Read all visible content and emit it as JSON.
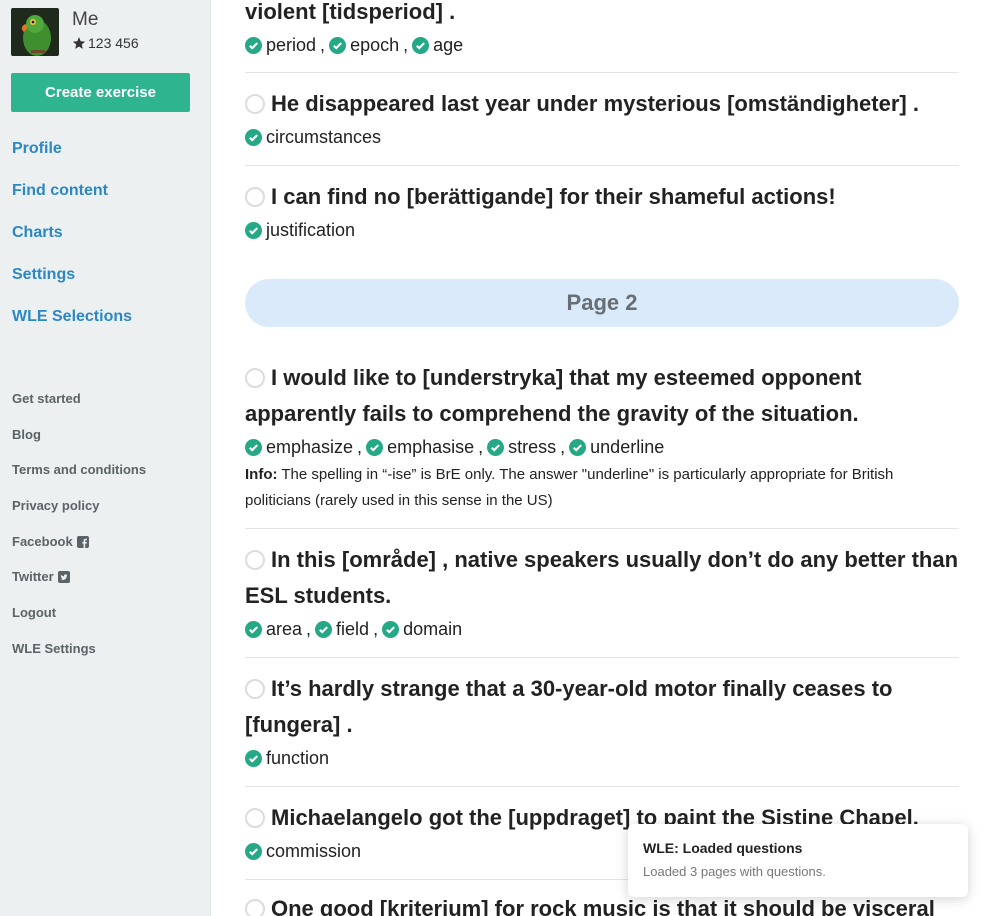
{
  "user": {
    "name": "Me",
    "score": "123 456"
  },
  "sidebar": {
    "create_label": "Create exercise",
    "main_links": [
      "Profile",
      "Find content",
      "Charts",
      "Settings",
      "WLE Selections"
    ],
    "secondary_links": [
      "Get started",
      "Blog",
      "Terms and conditions",
      "Privacy policy",
      "Facebook",
      "Twitter",
      "Logout",
      "WLE Settings"
    ]
  },
  "questions": [
    {
      "text": "violent [tidsperiod] .",
      "answers": [
        "period",
        "epoch",
        "age"
      ]
    },
    {
      "text": "He disappeared last year under mysterious [omständigheter] .",
      "answers": [
        "circumstances"
      ]
    },
    {
      "text": "I can find no [berättigande] for their shameful actions!",
      "answers": [
        "justification"
      ]
    },
    {
      "text": "I would like to [understryka] that my esteemed opponent apparently fails to comprehend the gravity of the situation.",
      "answers": [
        "emphasize",
        "emphasise",
        "stress",
        "underline"
      ],
      "info_label": "Info:",
      "info": " The spelling in “-ise” is BrE only. The answer \"underline\" is particularly appropriate for British politicians (rarely used in this sense in the US)"
    },
    {
      "text": "In this [område] , native speakers usually don’t do any better than ESL students.",
      "answers": [
        "area",
        "field",
        "domain"
      ]
    },
    {
      "text": "It’s hardly strange that a 30-year-old motor finally ceases to [fungera] .",
      "answers": [
        "function"
      ]
    },
    {
      "text": "Michaelangelo got the [uppdraget] to paint the Sistine Chapel.",
      "answers": [
        "commission"
      ]
    },
    {
      "text": "One good [kriterium] for rock music is that it should be visceral",
      "answers": []
    }
  ],
  "page_banner": "Page 2",
  "toast": {
    "title": "WLE: Loaded questions",
    "message": "Loaded 3 pages with questions."
  },
  "colors": {
    "accent": "#2eb58f",
    "link": "#2c88c4",
    "check": "#25a886",
    "banner": "#dbeafa"
  }
}
